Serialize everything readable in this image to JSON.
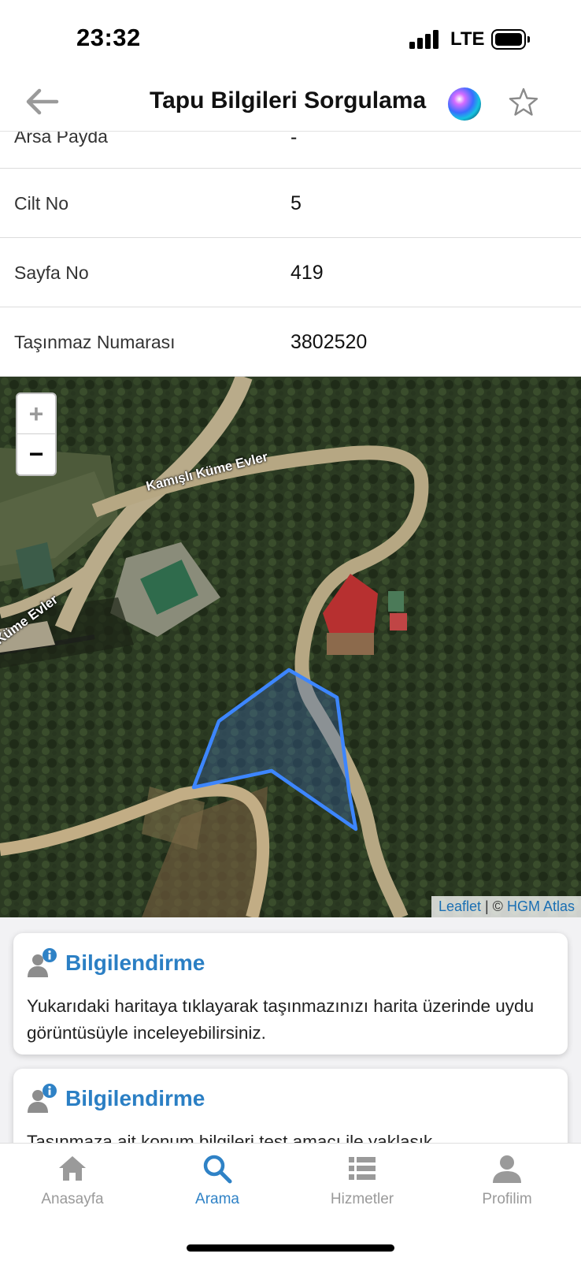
{
  "status_bar": {
    "time": "23:32",
    "network": "LTE",
    "icons": [
      "signal-icon",
      "battery-icon"
    ]
  },
  "header": {
    "title": "Tapu Bilgileri Sorgulama",
    "back_icon": "arrow-left-icon",
    "assistant_icon": "siri-icon",
    "favorite_icon": "star-icon"
  },
  "info_rows": [
    {
      "label": "Arsa Payda",
      "value": "-"
    },
    {
      "label": "Cilt No",
      "value": "5"
    },
    {
      "label": "Sayfa No",
      "value": "419"
    },
    {
      "label": "Taşınmaz Numarası",
      "value": "3802520"
    }
  ],
  "map": {
    "zoom_in": "+",
    "zoom_out": "−",
    "road_labels": [
      "Kamışlı Küme Evler",
      "Küme Evler"
    ],
    "attribution": {
      "leaflet": "Leaflet",
      "separator": "| ©",
      "provider": "HGM Atlas"
    },
    "parcel_outline_color": "#3d86ff"
  },
  "cards": [
    {
      "title": "Bilgilendirme",
      "icon": "user-info-icon",
      "text": "Yukarıdaki haritaya tıklayarak taşınmazınızı harita üzerinde uydu görüntüsüyle inceleyebilirsiniz."
    },
    {
      "title": "Bilgilendirme",
      "icon": "user-info-icon",
      "text": "Taşınmaza ait konum bilgileri test amacı ile yaklaşık"
    }
  ],
  "tabs": [
    {
      "label": "Anasayfa",
      "icon": "home-icon",
      "active": false
    },
    {
      "label": "Arama",
      "icon": "search-icon",
      "active": true
    },
    {
      "label": "Hizmetler",
      "icon": "list-icon",
      "active": false
    },
    {
      "label": "Profilim",
      "icon": "profile-icon",
      "active": false
    }
  ],
  "colors": {
    "accent": "#2f82c6",
    "card_title": "#2b7fc4",
    "inactive_tab": "#9a9a9a"
  }
}
